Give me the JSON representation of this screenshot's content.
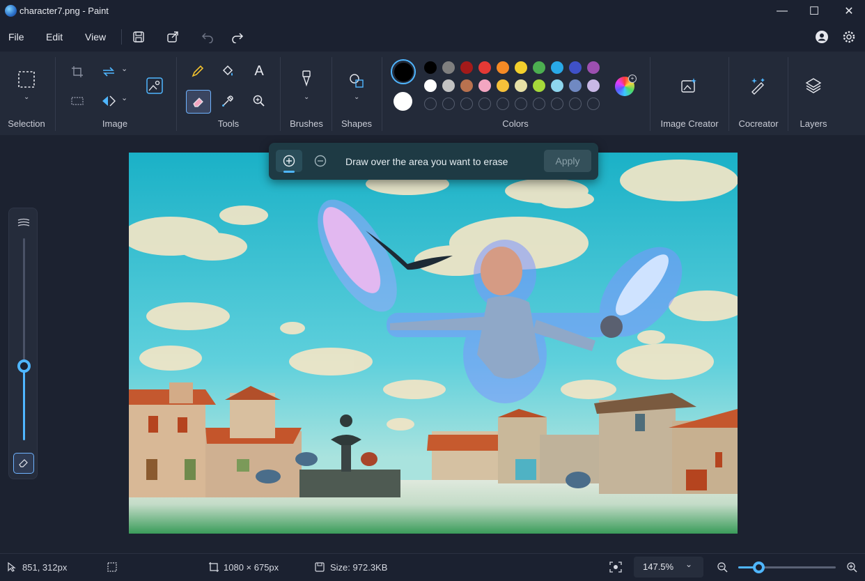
{
  "window": {
    "title": "character7.png - Paint",
    "minimize": "—",
    "maximize": "☐",
    "close": "✕"
  },
  "menu": {
    "items": [
      {
        "label": "File"
      },
      {
        "label": "Edit"
      },
      {
        "label": "View"
      }
    ]
  },
  "ribbon": {
    "groups": [
      {
        "label": "Selection"
      },
      {
        "label": "Image"
      },
      {
        "label": "Tools"
      },
      {
        "label": "Brushes"
      },
      {
        "label": "Shapes"
      },
      {
        "label": "Colors"
      },
      {
        "label": "Image Creator"
      },
      {
        "label": "Cocreator"
      },
      {
        "label": "Layers"
      }
    ],
    "text_tool_glyph": "A",
    "primary_color": "#000000",
    "secondary_color": "#ffffff",
    "palette_row1": [
      "#000000",
      "#7f7f7f",
      "#a31a1a",
      "#e53935",
      "#f58a25",
      "#f2cf2c",
      "#4caf50",
      "#29a9e8",
      "#3f51c8",
      "#9c4fb0"
    ],
    "palette_row2": [
      "#ffffff",
      "#c3c3c3",
      "#b9724f",
      "#f3a6c1",
      "#f6c13a",
      "#e6e0a6",
      "#a6d93a",
      "#8ed6ee",
      "#7089c2",
      "#c9b8e6"
    ]
  },
  "erase_toolbar": {
    "hint": "Draw over the area you want to erase",
    "apply_label": "Apply"
  },
  "brush_size_level": 0.37,
  "status": {
    "cursor_position": "851, 312px",
    "canvas_size": "1080 × 675px",
    "file_size": "Size: 972.3KB",
    "zoom": "147.5%",
    "zoom_slider_level": 0.21
  },
  "colors": {
    "accent": "#4fb6ff",
    "background": "#1c2230",
    "ribbon": "#232a39"
  }
}
